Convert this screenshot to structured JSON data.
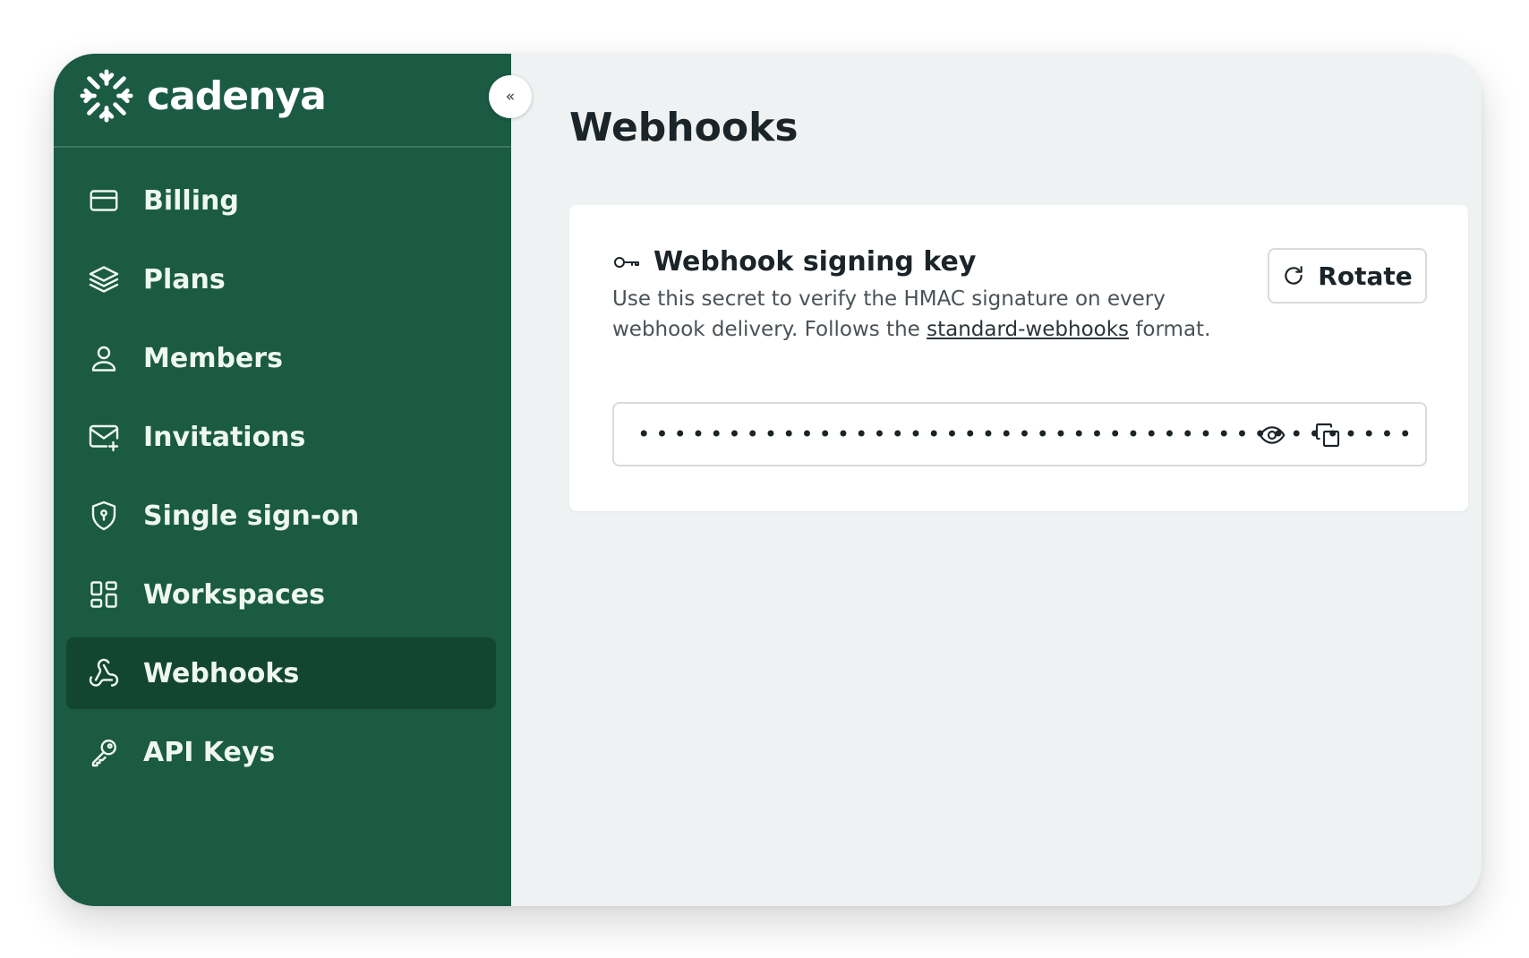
{
  "brand": {
    "name": "cadenya"
  },
  "sidebar": {
    "collapse_glyph": "«",
    "items": [
      {
        "label": "Billing",
        "icon": "credit-card-icon",
        "active": false
      },
      {
        "label": "Plans",
        "icon": "layers-icon",
        "active": false
      },
      {
        "label": "Members",
        "icon": "user-icon",
        "active": false
      },
      {
        "label": "Invitations",
        "icon": "mail-plus-icon",
        "active": false
      },
      {
        "label": "Single sign-on",
        "icon": "shield-icon",
        "active": false
      },
      {
        "label": "Workspaces",
        "icon": "layout-grid-icon",
        "active": false
      },
      {
        "label": "Webhooks",
        "icon": "webhook-icon",
        "active": true
      },
      {
        "label": "API Keys",
        "icon": "key-icon",
        "active": false
      }
    ]
  },
  "main": {
    "title": "Webhooks",
    "card": {
      "title": "Webhook signing key",
      "description_before": "Use this secret to verify the HMAC signature on every webhook delivery. Follows the ",
      "description_link": "standard-webhooks",
      "description_after": " format.",
      "rotate_label": "Rotate",
      "secret_masked": "•••••••••••••••••••••••••••••••••••••••••••"
    }
  },
  "colors": {
    "sidebar_bg": "#1b5a43",
    "sidebar_active": "#134533",
    "main_bg": "#eef2f2",
    "text_dark": "#1b2428"
  }
}
